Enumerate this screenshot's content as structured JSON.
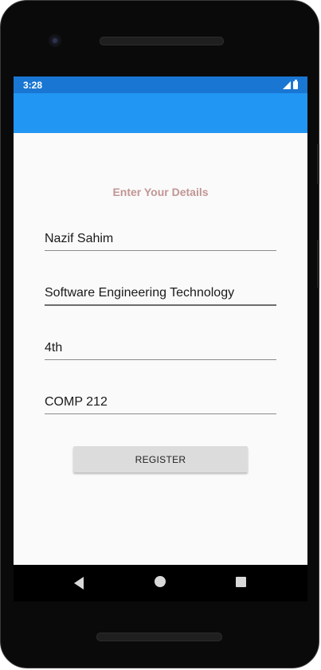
{
  "status_bar": {
    "time": "3:28",
    "icons": [
      "signal-icon",
      "battery-icon"
    ]
  },
  "app_bar": {
    "color": "#2196f3",
    "status_color": "#1976d2"
  },
  "form": {
    "heading": "Enter Your Details",
    "heading_color": "#c29595",
    "fields": [
      {
        "value": "Nazif Sahim"
      },
      {
        "value": "Software Engineering Technology"
      },
      {
        "value": "4th"
      },
      {
        "value": "COMP 212"
      }
    ],
    "register_label": "REGISTER"
  },
  "nav_bar": {
    "icons": [
      "back-icon",
      "home-icon",
      "recents-icon"
    ]
  }
}
